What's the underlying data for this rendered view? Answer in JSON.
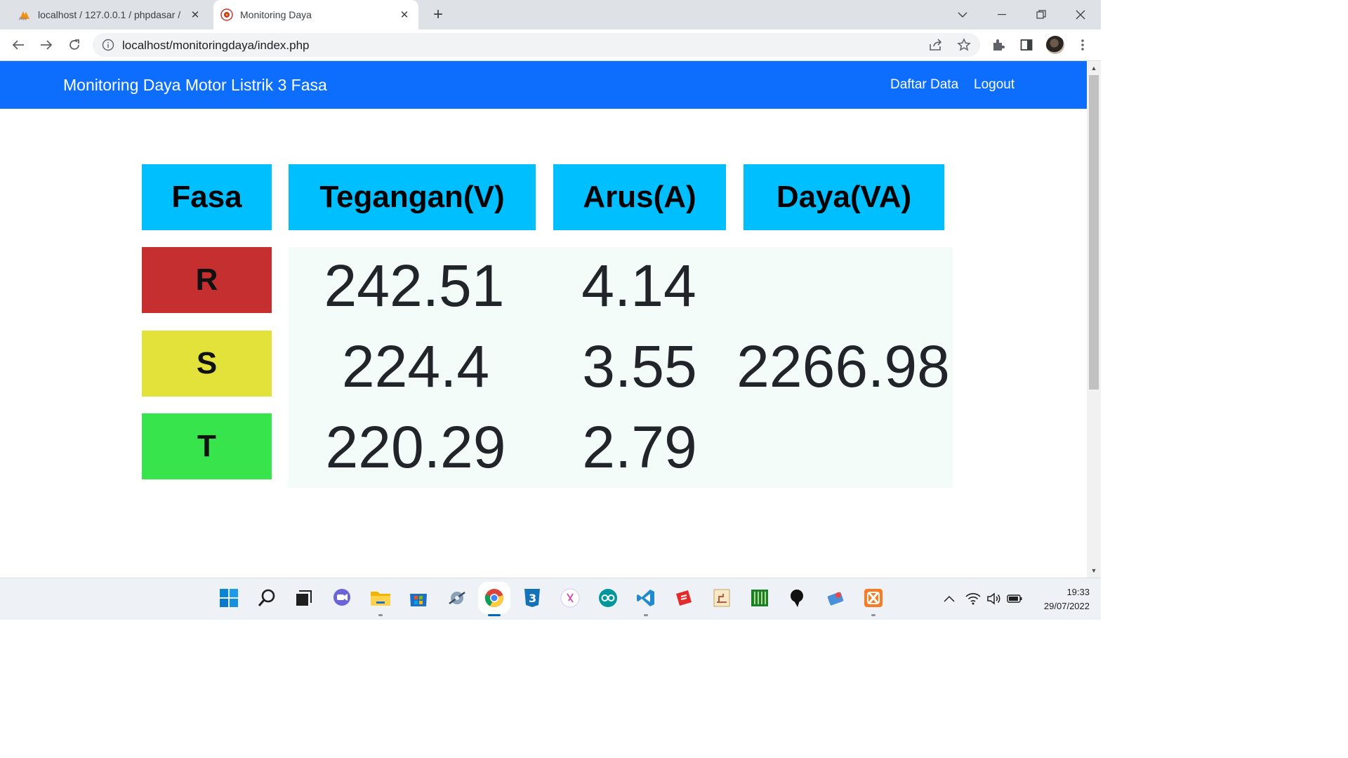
{
  "browser": {
    "tabs": [
      {
        "title": "localhost / 127.0.0.1 / phpdasar /",
        "active": false
      },
      {
        "title": "Monitoring Daya",
        "active": true
      }
    ],
    "url": "localhost/monitoringdaya/index.php"
  },
  "navbar": {
    "brand": "Monitoring Daya Motor Listrik 3 Fasa",
    "links": [
      "Daftar Data",
      "Logout"
    ],
    "color": "#0d6efd"
  },
  "table": {
    "headers": [
      "Fasa",
      "Tegangan(V)",
      "Arus(A)",
      "Daya(VA)"
    ],
    "header_color": "#00bfff",
    "phases": [
      {
        "label": "R",
        "color": "#c62f2f",
        "tegangan": "242.51",
        "arus": "4.14"
      },
      {
        "label": "S",
        "color": "#e2e23a",
        "tegangan": "224.4",
        "arus": "3.55"
      },
      {
        "label": "T",
        "color": "#38e44b",
        "tegangan": "220.29",
        "arus": "2.79"
      }
    ],
    "daya": "2266.98"
  },
  "taskbar": {
    "apps": [
      "start",
      "search",
      "task-view",
      "chat",
      "file-explorer",
      "microsoft-store",
      "app",
      "chrome",
      "css3",
      "app",
      "arduino",
      "vscode",
      "app",
      "app",
      "app",
      "app",
      "app",
      "xampp"
    ],
    "time": "19:33",
    "date": "29/07/2022"
  }
}
